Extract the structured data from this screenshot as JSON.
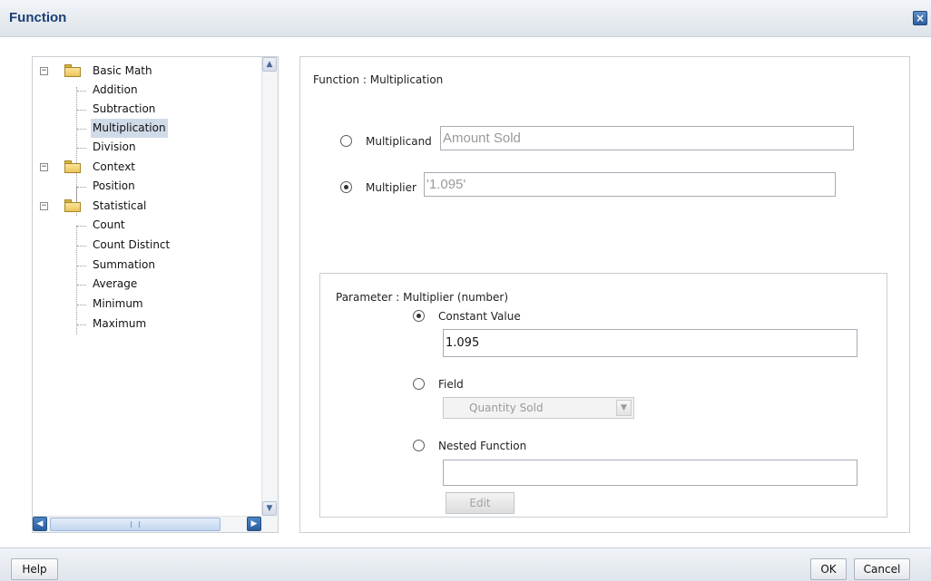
{
  "window": {
    "title": "Function"
  },
  "tree": {
    "groups": [
      {
        "label": "Basic Math",
        "items": [
          "Addition",
          "Subtraction",
          "Multiplication",
          "Division"
        ]
      },
      {
        "label": "Context",
        "items": [
          "Position"
        ]
      },
      {
        "label": "Statistical",
        "items": [
          "Count",
          "Count Distinct",
          "Summation",
          "Average",
          "Minimum",
          "Maximum"
        ]
      }
    ],
    "selected": "Multiplication"
  },
  "main": {
    "function_title": "Function : Multiplication",
    "multiplicand": {
      "label": "Multiplicand",
      "value": "Amount Sold",
      "checked": false
    },
    "multiplier": {
      "label": "Multiplier",
      "value": "'1.095'",
      "checked": true
    }
  },
  "parameter": {
    "title": "Parameter : Multiplier (number)",
    "constant": {
      "label": "Constant Value",
      "value": "1.095",
      "checked": true
    },
    "field": {
      "label": "Field",
      "selected": "Quantity Sold",
      "checked": false
    },
    "nested": {
      "label": "Nested Function",
      "value": "",
      "checked": false
    },
    "edit_label": "Edit"
  },
  "footer": {
    "help_label": "Help",
    "ok_label": "OK",
    "cancel_label": "Cancel"
  },
  "icons": {
    "close": "close-icon",
    "folder": "folder-icon"
  },
  "colors": {
    "title": "#1a3f73",
    "selection": "#cfdbe8"
  }
}
